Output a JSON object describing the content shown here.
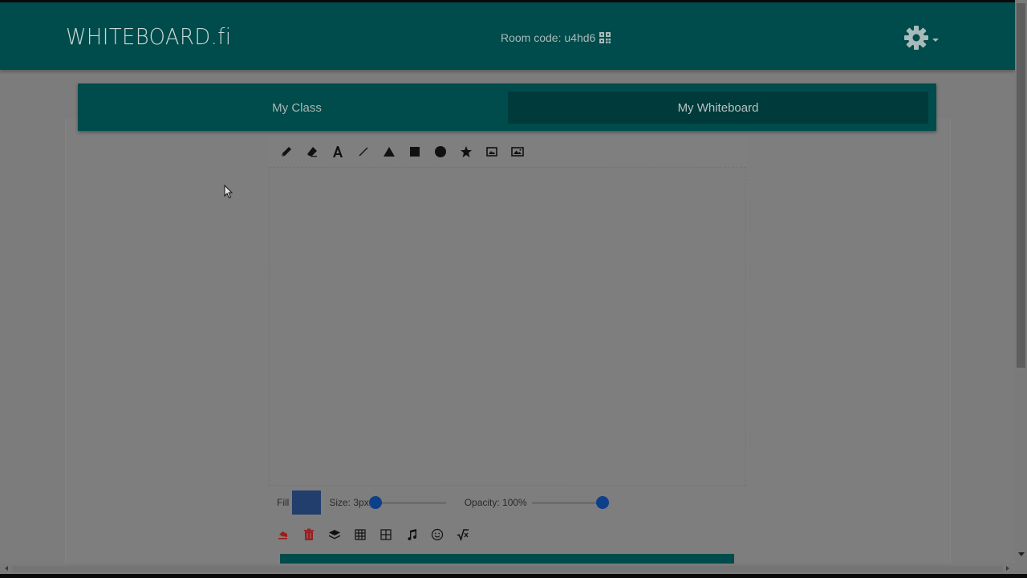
{
  "app": {
    "logo": "WHITEBOARD.fi",
    "room_code": "Room code: u4hd6",
    "accent": "#004b4b"
  },
  "tabs": [
    {
      "label": "My Class",
      "active": false
    },
    {
      "label": "My Whiteboard",
      "active": true
    }
  ],
  "toolbar": {
    "tools": [
      "pencil-icon",
      "eraser-icon",
      "text-icon",
      "line-icon",
      "triangle-icon",
      "rectangle-icon",
      "circle-icon",
      "star-icon",
      "image-icon",
      "picture-icon"
    ]
  },
  "settings": {
    "fill_label": "Fill",
    "fill_color": "#223e6c",
    "size_label": "Size: 3px",
    "size_value": 0,
    "opacity_label": "Opacity: 100%",
    "opacity_value": 1.0
  },
  "actions": {
    "items": [
      "undo-icon",
      "trash-icon",
      "layers-icon",
      "grid-icon",
      "grid-large-icon",
      "music-note-icon",
      "smiley-icon",
      "math-sqrt-icon"
    ]
  }
}
